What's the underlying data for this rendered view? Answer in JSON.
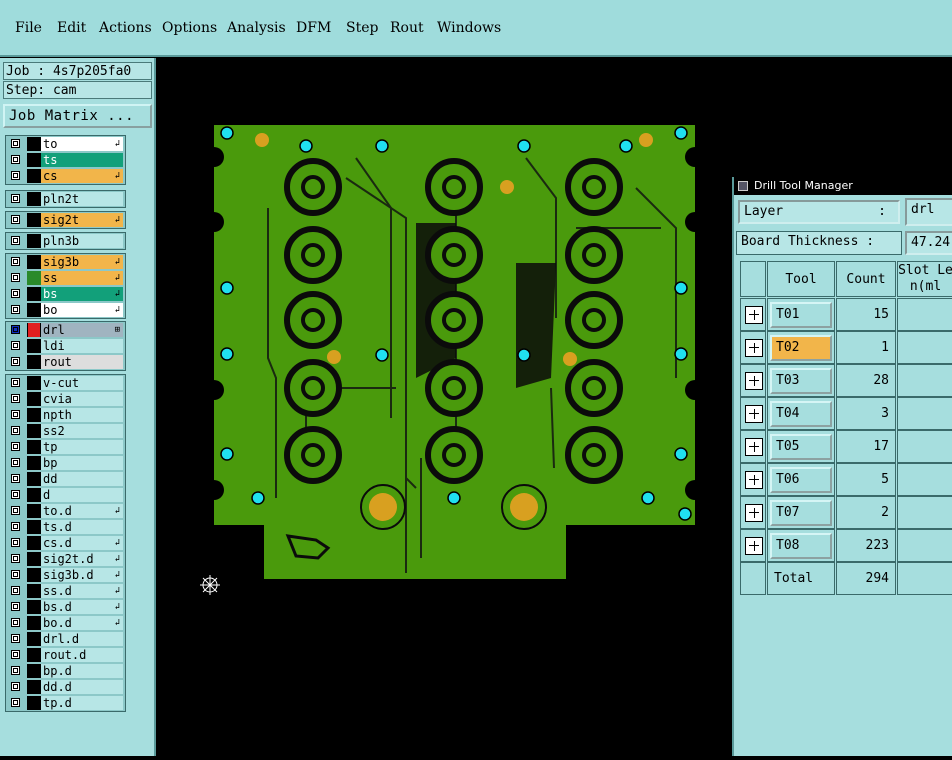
{
  "menu": {
    "file": "File",
    "edit": "Edit",
    "actions": "Actions",
    "options": "Options",
    "analysis": "Analysis",
    "dfm": "DFM",
    "step": "Step",
    "rout": "Rout",
    "windows": "Windows"
  },
  "job_label": "Job : 4s7p205fa0",
  "step_label": "Step: cam",
  "job_matrix_button": "Job Matrix ...",
  "layer_groups": [
    [
      {
        "name": "to",
        "color": "#ffffff",
        "flag": "↲"
      },
      {
        "name": "ts",
        "color": "#12a07a",
        "flag": ""
      },
      {
        "name": "cs",
        "color": "#f2b54a",
        "flag": "↲"
      }
    ],
    [
      {
        "name": "pln2t",
        "color": "#b7e6e6",
        "flag": ""
      }
    ],
    [
      {
        "name": "sig2t",
        "color": "#f2b54a",
        "flag": "↲"
      }
    ],
    [
      {
        "name": "pln3b",
        "color": "#b7e6e6",
        "flag": ""
      }
    ],
    [
      {
        "name": "sig3b",
        "color": "#f2b54a",
        "flag": "↲"
      },
      {
        "name": "ss",
        "color": "#f2b54a",
        "flag": "↲"
      },
      {
        "name": "bs",
        "color": "#12a07a",
        "flag": "↲"
      },
      {
        "name": "bo",
        "color": "#ffffff",
        "flag": "↲"
      }
    ],
    [
      {
        "name": "drl",
        "color": "#a0b4c0",
        "flag": "⊞"
      },
      {
        "name": "ldi",
        "color": "#b7e6e6",
        "flag": ""
      },
      {
        "name": "rout",
        "color": "#dddddd",
        "flag": ""
      }
    ],
    [
      {
        "name": "v-cut",
        "color": "#b7e6e6",
        "flag": ""
      },
      {
        "name": "cvia",
        "color": "#b7e6e6",
        "flag": ""
      },
      {
        "name": "npth",
        "color": "#b7e6e6",
        "flag": ""
      },
      {
        "name": "ss2",
        "color": "#b7e6e6",
        "flag": ""
      },
      {
        "name": "tp",
        "color": "#b7e6e6",
        "flag": ""
      },
      {
        "name": "bp",
        "color": "#b7e6e6",
        "flag": ""
      },
      {
        "name": "dd",
        "color": "#b7e6e6",
        "flag": ""
      },
      {
        "name": "d",
        "color": "#b7e6e6",
        "flag": ""
      },
      {
        "name": "to.d",
        "color": "#b7e6e6",
        "flag": "↲"
      },
      {
        "name": "ts.d",
        "color": "#b7e6e6",
        "flag": ""
      },
      {
        "name": "cs.d",
        "color": "#b7e6e6",
        "flag": "↲"
      },
      {
        "name": "sig2t.d",
        "color": "#b7e6e6",
        "flag": "↲"
      },
      {
        "name": "sig3b.d",
        "color": "#b7e6e6",
        "flag": "↲"
      },
      {
        "name": "ss.d",
        "color": "#b7e6e6",
        "flag": "↲"
      },
      {
        "name": "bs.d",
        "color": "#b7e6e6",
        "flag": "↲"
      },
      {
        "name": "bo.d",
        "color": "#b7e6e6",
        "flag": "↲"
      },
      {
        "name": "drl.d",
        "color": "#b7e6e6",
        "flag": ""
      },
      {
        "name": "rout.d",
        "color": "#b7e6e6",
        "flag": ""
      },
      {
        "name": "bp.d",
        "color": "#b7e6e6",
        "flag": ""
      },
      {
        "name": "dd.d",
        "color": "#b7e6e6",
        "flag": ""
      },
      {
        "name": "tp.d",
        "color": "#b7e6e6",
        "flag": ""
      }
    ]
  ],
  "drill_tool_manager": {
    "title": "Drill Tool Manager",
    "layer_label": "Layer",
    "layer_colon": ":",
    "layer_value": "drl",
    "thickness_label": "Board Thickness :",
    "thickness_value": "47.24",
    "headers": {
      "tool": "Tool",
      "count": "Count",
      "slot": "Slot Len(ml"
    },
    "tools": [
      {
        "tool": "T01",
        "count": "15",
        "selected": false
      },
      {
        "tool": "T02",
        "count": "1",
        "selected": true
      },
      {
        "tool": "T03",
        "count": "28",
        "selected": false
      },
      {
        "tool": "T04",
        "count": "3",
        "selected": false
      },
      {
        "tool": "T05",
        "count": "17",
        "selected": false
      },
      {
        "tool": "T06",
        "count": "5",
        "selected": false
      },
      {
        "tool": "T07",
        "count": "2",
        "selected": false
      },
      {
        "tool": "T08",
        "count": "223",
        "selected": false
      }
    ],
    "total_label": "Total",
    "total_value": "294"
  },
  "colors": {
    "ui_bg": "#a6dede",
    "board_green": "#4a9a0c",
    "pad_cyan": "#20e0f0",
    "pad_gold": "#d8a020",
    "selected_tool": "#f2b54a"
  }
}
